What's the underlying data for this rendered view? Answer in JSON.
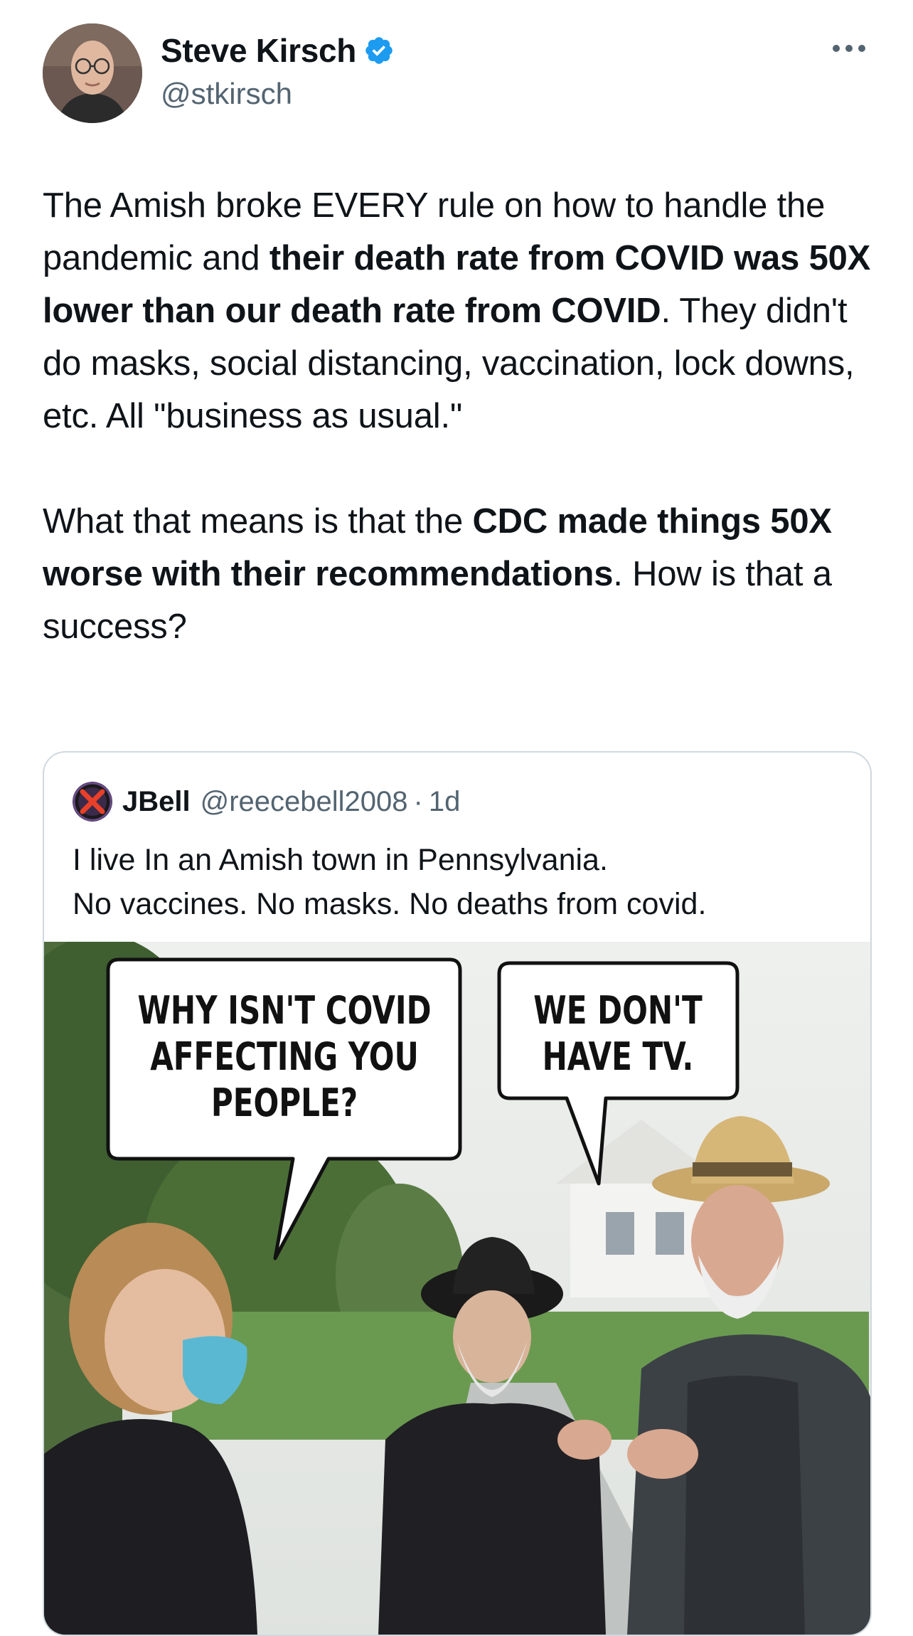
{
  "author": {
    "display_name": "Steve Kirsch",
    "handle": "@stkirsch",
    "verified": true
  },
  "tweet": {
    "paragraphs": [
      [
        {
          "text": "The Amish broke EVERY rule on how to handle the pandemic and ",
          "bold": false
        },
        {
          "text": "their death rate from COVID was 50X lower than our death rate from COVID",
          "bold": true
        },
        {
          "text": ". They didn't do masks, social distancing, vaccination, lock downs, etc. All \"business as usual.\"",
          "bold": false
        }
      ],
      [
        {
          "text": "What that means is that the ",
          "bold": false
        },
        {
          "text": "CDC made things 50X worse with their recommendations",
          "bold": true
        },
        {
          "text": ". How is that a success?",
          "bold": false
        }
      ]
    ]
  },
  "quoted_tweet": {
    "display_name": "JBell",
    "handle": "@reecebell2008",
    "separator": "·",
    "time": "1d",
    "lines": [
      "I live In an Amish town in Pennsylvania.",
      "No vaccines. No masks. No deaths from covid."
    ],
    "meme": {
      "bubble_left": [
        "WHY ISN'T COVID",
        "AFFECTING YOU",
        "PEOPLE?"
      ],
      "bubble_right": [
        "WE DON'T",
        "HAVE TV."
      ]
    }
  },
  "colors": {
    "text": "#0f1419",
    "secondary": "#536471",
    "verified_blue": "#1d9bf0",
    "border": "#cfd9de"
  },
  "icons": {
    "verified": "verified-badge-icon",
    "more": "more-horizontal-icon"
  }
}
